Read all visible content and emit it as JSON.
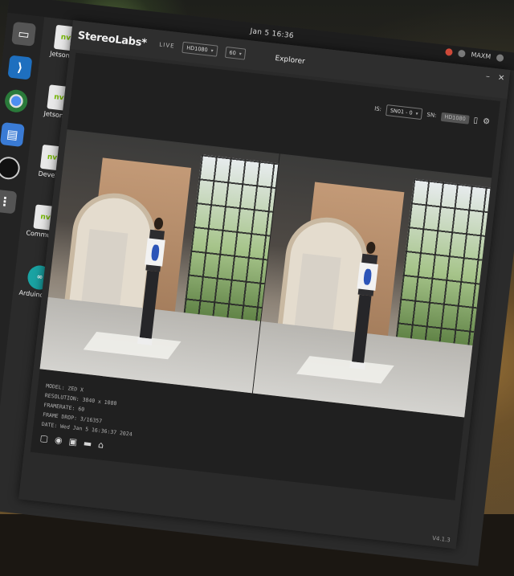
{
  "topbar": {
    "clock": "Jan 5 16:36",
    "user": "MAXM"
  },
  "desktop": {
    "icons": [
      {
        "label": "Jetson Ap",
        "glyph": "nvi"
      },
      {
        "label": "Jetson Ut",
        "glyph": "nvi"
      },
      {
        "label": "Develop",
        "glyph": "nvi"
      },
      {
        "label": "Community",
        "glyph": "nvi"
      },
      {
        "label": "Arduino IDE",
        "glyph": "∞"
      }
    ]
  },
  "app": {
    "brand": "StereoLabs*",
    "live_label": "LIVE",
    "source_select": "HD1080",
    "fps_select": "60",
    "title": "Explorer",
    "controls": {
      "camera_label": "IS:",
      "camera_select": "SN01 - 0",
      "recording_label": "SN:",
      "recording_value": "HD1080"
    },
    "info": [
      "MODEL: ZED X",
      "RESOLUTION: 3840 x 1080",
      "FRAMERATE: 60",
      "FRAME DROP: 3/16357",
      "DATE: Wed Jan 5 16:36:37 2024"
    ],
    "version": "V4.1.3"
  },
  "colors": {
    "accent_nvidia": "#76b900",
    "window_bg": "#2a2a2a"
  }
}
